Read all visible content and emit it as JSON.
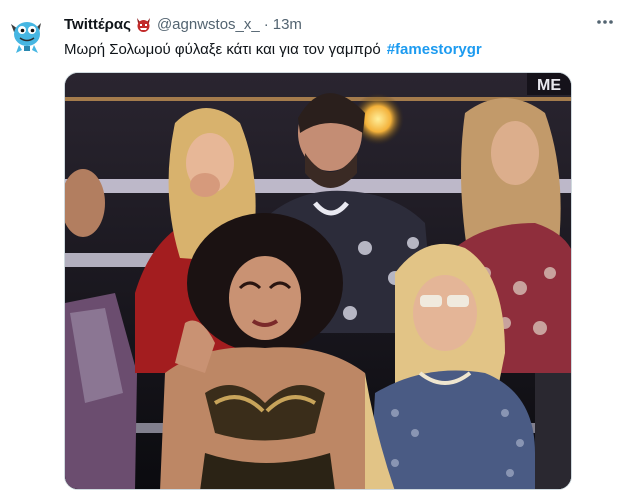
{
  "tweet": {
    "display_name": "Twittέρας",
    "badge_icon": "devil-emoji-icon",
    "handle": "@agnwstos_x_",
    "separator": "·",
    "time": "13m",
    "text": "Μωρή Σολωμού φύλαξε κάτι και για τον γαμπρό",
    "hashtag": "#famestorygr",
    "more_icon": "more-options-icon"
  },
  "media": {
    "stage_sign": "ME"
  },
  "colors": {
    "text": "#0f1419",
    "secondary": "#536471",
    "link": "#1d9bf0",
    "border": "#cfd9de"
  }
}
